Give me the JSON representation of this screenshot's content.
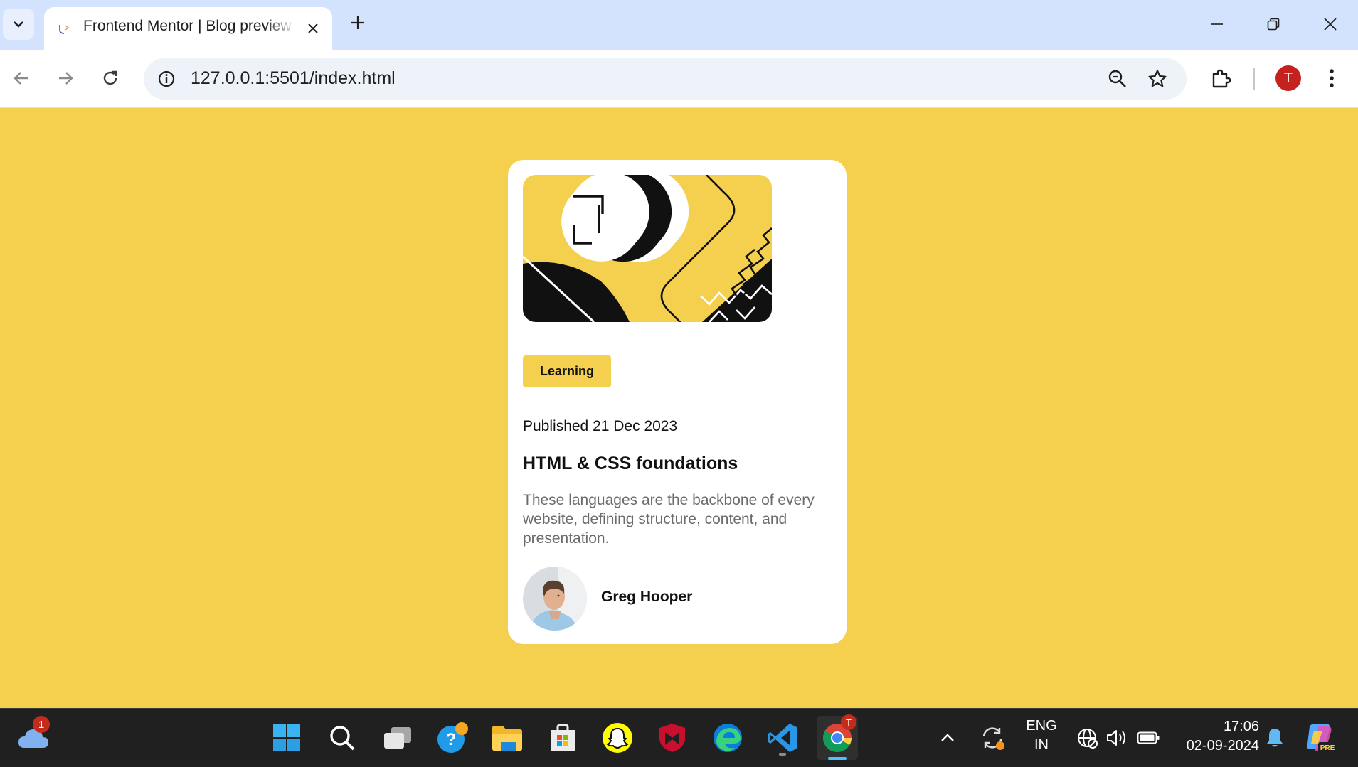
{
  "browser": {
    "tab_title": "Frontend Mentor | Blog preview card",
    "url": "127.0.0.1:5501/index.html",
    "profile_initial": "T"
  },
  "card": {
    "tag": "Learning",
    "published": "Published 21 Dec 2023",
    "title": "HTML & CSS foundations",
    "description": "These languages are the backbone of every website, defining structure, content, and presentation.",
    "author": "Greg Hooper"
  },
  "taskbar": {
    "weather_badge": "1",
    "chrome_badge": "T",
    "language_line1": "ENG",
    "language_line2": "IN",
    "time": "17:06",
    "date": "02-09-2024"
  },
  "colors": {
    "page_background": "#f4d04e",
    "card_background": "#ffffff",
    "text_primary": "#111111",
    "text_secondary": "#6b6b6b",
    "profile": "#c5221f"
  }
}
